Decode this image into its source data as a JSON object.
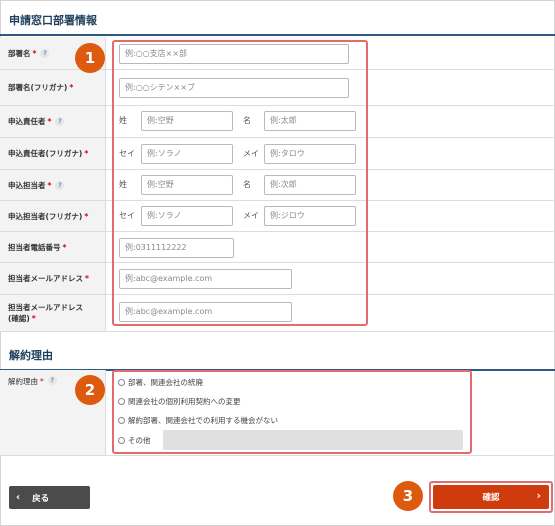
{
  "section1": {
    "title": "申請窓口部署情報",
    "badge": "1",
    "rows": [
      {
        "label": "部署名",
        "req": "*",
        "help": "?",
        "placeholder": "例:○○支店××部"
      },
      {
        "label": "部署名(フリガナ)",
        "req": "*",
        "placeholder": "例:○○シテン××ブ"
      },
      {
        "label": "申込責任者",
        "req": "*",
        "help": "?",
        "sub1": "姓",
        "ph1": "例:空野",
        "sub2": "名",
        "ph2": "例:太郎"
      },
      {
        "label": "申込責任者(フリガナ)",
        "req": "*",
        "sub1": "セイ",
        "ph1": "例:ソラノ",
        "sub2": "メイ",
        "ph2": "例:タロウ"
      },
      {
        "label": "申込担当者",
        "req": "*",
        "help": "?",
        "sub1": "姓",
        "ph1": "例:空野",
        "sub2": "名",
        "ph2": "例:次郎"
      },
      {
        "label": "申込担当者(フリガナ)",
        "req": "*",
        "sub1": "セイ",
        "ph1": "例:ソラノ",
        "sub2": "メイ",
        "ph2": "例:ジロウ"
      },
      {
        "label": "担当者電話番号",
        "req": "*",
        "placeholder": "例:0311112222"
      },
      {
        "label": "担当者メールアドレス",
        "req": "*",
        "placeholder": "例:abc@example.com"
      },
      {
        "label": "担当者メールアドレス",
        "label2": "(確認)",
        "req": "*",
        "placeholder": "例:abc@example.com"
      }
    ]
  },
  "section2": {
    "title": "解約理由",
    "badge": "2",
    "label": "解約理由",
    "req": "*",
    "help": "?",
    "options": [
      "部署、関連会社の統廃",
      "関連会社の個別利用契約への変更",
      "解約部署、関連会社での利用する機会がない",
      "その他"
    ]
  },
  "footer": {
    "back_label": "戻る",
    "confirm_label": "確認",
    "badge": "3"
  }
}
